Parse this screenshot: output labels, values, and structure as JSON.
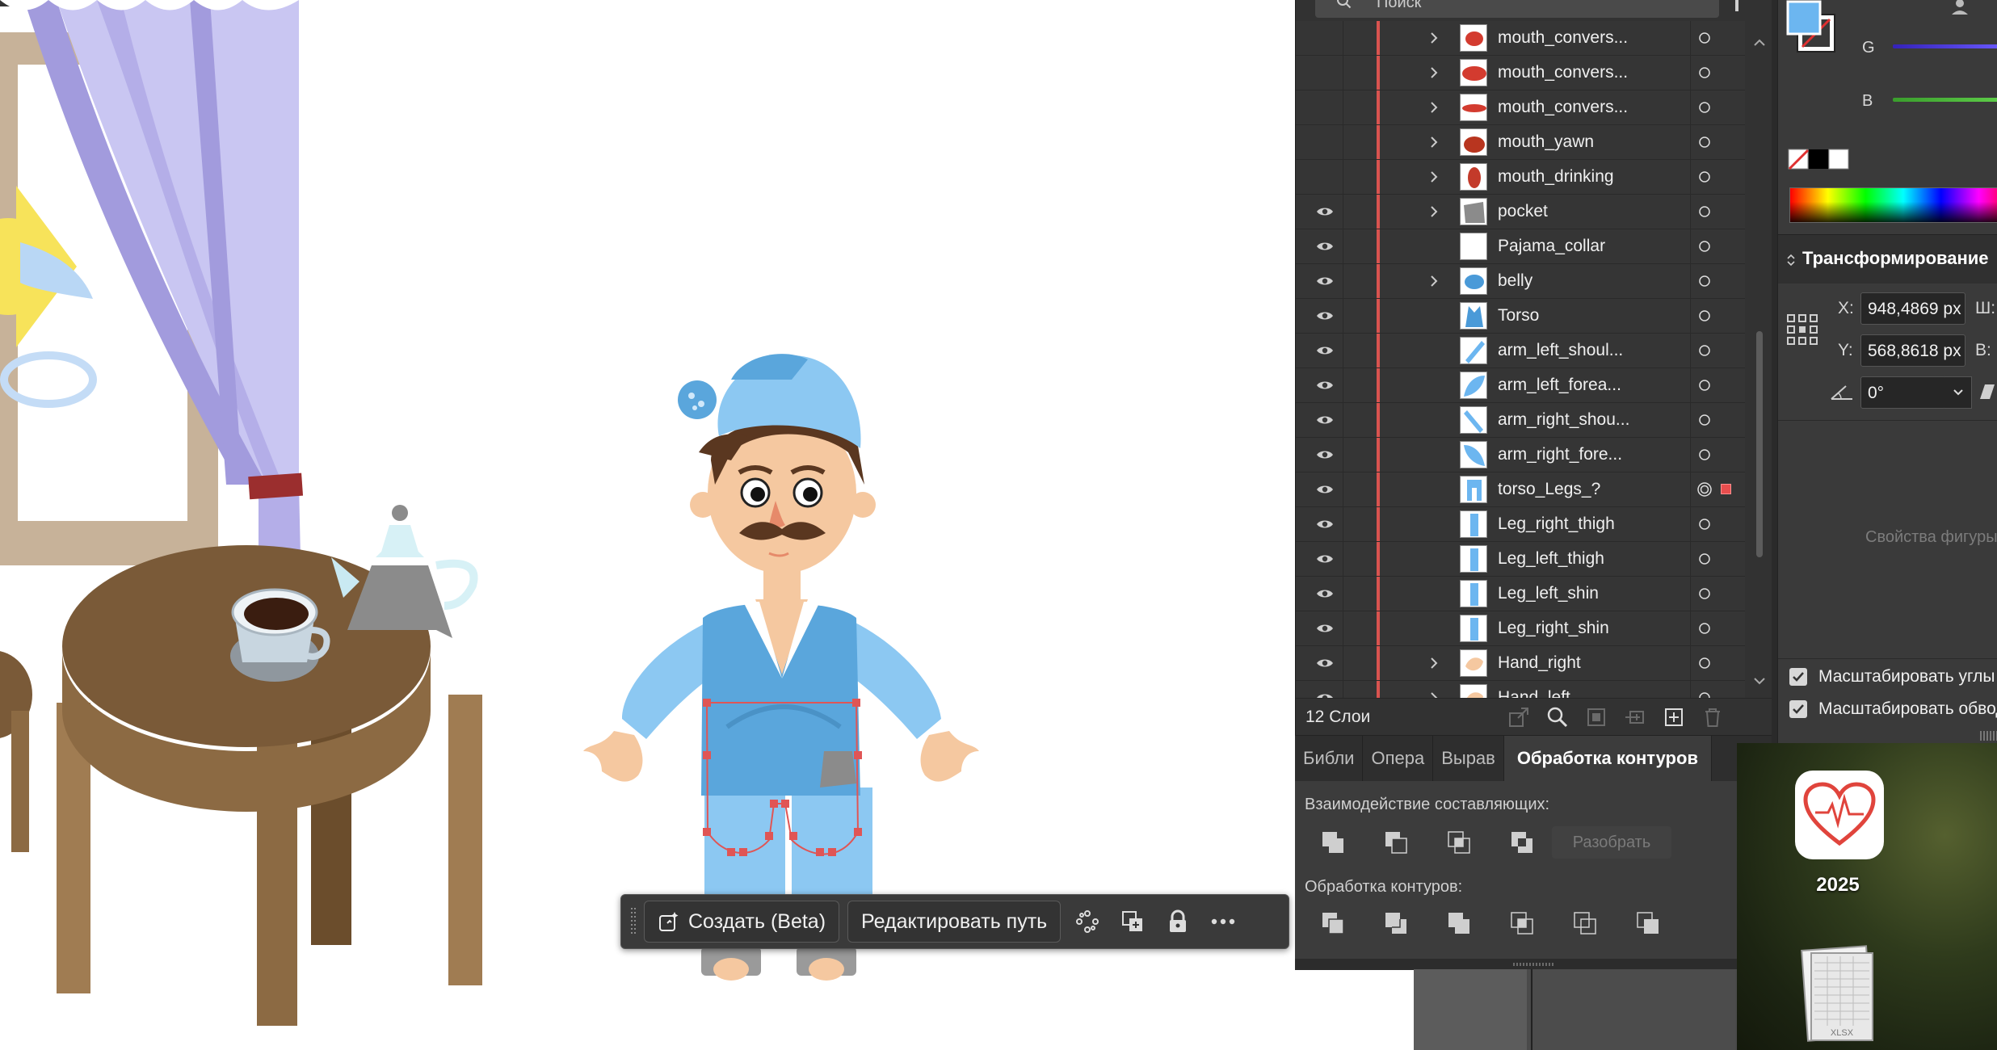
{
  "canvas": {
    "taskbar": {
      "create_label": "Создать (Beta)",
      "edit_path_label": "Редактировать путь"
    }
  },
  "layers": {
    "search_placeholder": "Поиск",
    "items": [
      {
        "name": "mouth_convers...",
        "visible": false,
        "expandable": true,
        "thumb": "mouth-red-oval"
      },
      {
        "name": "mouth_convers...",
        "visible": false,
        "expandable": true,
        "thumb": "mouth-red-wide"
      },
      {
        "name": "mouth_convers...",
        "visible": false,
        "expandable": true,
        "thumb": "mouth-red-thin"
      },
      {
        "name": "mouth_yawn",
        "visible": false,
        "expandable": true,
        "thumb": "mouth-yawn"
      },
      {
        "name": "mouth_drinking",
        "visible": false,
        "expandable": true,
        "thumb": "mouth-drink"
      },
      {
        "name": "pocket",
        "visible": true,
        "expandable": true,
        "thumb": "pocket-gray"
      },
      {
        "name": "Pajama_collar",
        "visible": true,
        "expandable": false,
        "thumb": "blank"
      },
      {
        "name": "belly",
        "visible": true,
        "expandable": true,
        "thumb": "blue-oval"
      },
      {
        "name": "Torso",
        "visible": true,
        "expandable": false,
        "thumb": "torso-blue"
      },
      {
        "name": "arm_left_shoul...",
        "visible": true,
        "expandable": false,
        "thumb": "arm-stripe"
      },
      {
        "name": "arm_left_forea...",
        "visible": true,
        "expandable": false,
        "thumb": "arm-leaf"
      },
      {
        "name": "arm_right_shou...",
        "visible": true,
        "expandable": false,
        "thumb": "arm-stripe-r"
      },
      {
        "name": "arm_right_fore...",
        "visible": true,
        "expandable": false,
        "thumb": "arm-leaf-r"
      },
      {
        "name": "torso_Legs_?",
        "visible": true,
        "expandable": false,
        "thumb": "legs-blue",
        "targeted": true
      },
      {
        "name": "Leg_right_thigh",
        "visible": true,
        "expandable": false,
        "thumb": "leg-bar"
      },
      {
        "name": "Leg_left_thigh",
        "visible": true,
        "expandable": false,
        "thumb": "leg-bar"
      },
      {
        "name": "Leg_left_shin",
        "visible": true,
        "expandable": false,
        "thumb": "leg-bar"
      },
      {
        "name": "Leg_right_shin",
        "visible": true,
        "expandable": false,
        "thumb": "leg-bar"
      },
      {
        "name": "Hand_right",
        "visible": true,
        "expandable": true,
        "thumb": "hand"
      },
      {
        "name": "Hand_left",
        "visible": true,
        "expandable": true,
        "thumb": "hand"
      }
    ],
    "count_label": "12 Слои"
  },
  "pathfinder": {
    "tabs": [
      "Библи",
      "Опера",
      "Вырав",
      "Обработка контуров"
    ],
    "active_tab": "Обработка контуров",
    "shape_modes_label": "Взаимодействие составляющих:",
    "expand_label": "Разобрать",
    "pathfinders_label": "Обработка контуров:"
  },
  "properties": {
    "channel_g": "G",
    "channel_b": "B",
    "transform_title": "Трансформирование",
    "x_label": "X:",
    "x_value": "948,4869 px",
    "w_label": "Ш:",
    "y_label": "Y:",
    "y_value": "568,8618 px",
    "h_label": "В:",
    "rotate_value": "0°",
    "shape_properties": "Свойства фигуры",
    "scale_corners": "Масштабировать углы",
    "scale_strokes": "Масштабировать обводку",
    "fill_color": "#6cb6f0",
    "channel_g_color": "#5a4cff",
    "channel_b_color": "#4bbf3a"
  },
  "desktop": {
    "app_label": "2025",
    "file_label": "XLSX"
  }
}
